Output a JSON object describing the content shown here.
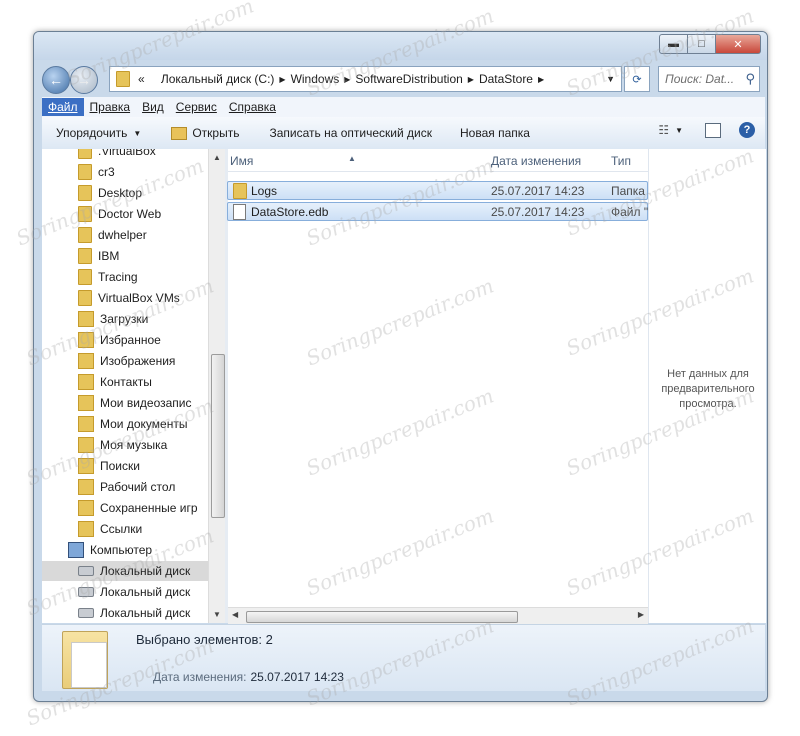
{
  "window": {
    "buttons": {
      "minimize": "▬",
      "maximize": "□",
      "close": "✕"
    }
  },
  "nav": {
    "back_glyph": "←",
    "forward_glyph": "→",
    "address": {
      "root": "«",
      "crumbs": [
        "Локальный диск (C:)",
        "Windows",
        "SoftwareDistribution",
        "DataStore"
      ]
    },
    "search_placeholder": "Поиск: Dat..."
  },
  "menu": [
    "Файл",
    "Правка",
    "Вид",
    "Сервис",
    "Справка"
  ],
  "toolbar": {
    "organize": "Упорядочить",
    "open": "Открыть",
    "burn": "Записать на оптический диск",
    "new_folder": "Новая папка",
    "help": "?"
  },
  "sidebar": {
    "items": [
      {
        "label": ".VirtualBox",
        "icon": "folder-icon"
      },
      {
        "label": "cr3",
        "icon": "folder-icon"
      },
      {
        "label": "Desktop",
        "icon": "folder-icon"
      },
      {
        "label": "Doctor Web",
        "icon": "folder-icon"
      },
      {
        "label": "dwhelper",
        "icon": "folder-icon"
      },
      {
        "label": "IBM",
        "icon": "folder-icon"
      },
      {
        "label": "Tracing",
        "icon": "folder-icon"
      },
      {
        "label": "VirtualBox VMs",
        "icon": "folder-icon"
      },
      {
        "label": "Загрузки",
        "icon": "downloads-icon"
      },
      {
        "label": "Избранное",
        "icon": "favorites-icon"
      },
      {
        "label": "Изображения",
        "icon": "pictures-icon"
      },
      {
        "label": "Контакты",
        "icon": "contacts-icon"
      },
      {
        "label": "Мои видеозапис",
        "icon": "videos-icon"
      },
      {
        "label": "Мои документы",
        "icon": "documents-icon"
      },
      {
        "label": "Моя музыка",
        "icon": "music-icon"
      },
      {
        "label": "Поиски",
        "icon": "searches-icon"
      },
      {
        "label": "Рабочий стол",
        "icon": "desktop-icon"
      },
      {
        "label": "Сохраненные игр",
        "icon": "saved-games-icon"
      },
      {
        "label": "Ссылки",
        "icon": "links-icon"
      },
      {
        "label": "Компьютер",
        "icon": "computer-icon"
      },
      {
        "label": "Локальный диск",
        "icon": "drive-icon"
      },
      {
        "label": "Локальный диск",
        "icon": "drive-icon"
      },
      {
        "label": "Локальный диск",
        "icon": "drive-icon"
      }
    ]
  },
  "list": {
    "columns": {
      "name": "Имя",
      "date": "Дата изменения",
      "type": "Тип"
    },
    "rows": [
      {
        "name": "Logs",
        "date": "25.07.2017 14:23",
        "type": "Папка"
      },
      {
        "name": "DataStore.edb",
        "date": "25.07.2017 14:23",
        "type": "Файл \""
      }
    ]
  },
  "preview": {
    "message": "Нет данных для предварительного просмотра."
  },
  "status": {
    "selected": "Выбрано элементов: 2",
    "date_label": "Дата изменения:",
    "date_value": "25.07.2017 14:23"
  },
  "watermark": "Soringpcrepair.com"
}
